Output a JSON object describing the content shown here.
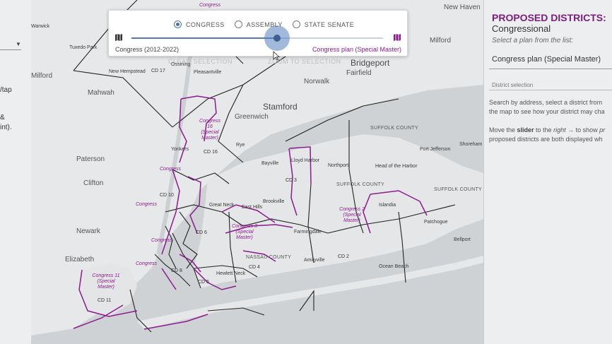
{
  "left_panel": {
    "lines": [
      "/tap",
      "&",
      "int)."
    ]
  },
  "plan_selector": {
    "options": [
      {
        "label": "CONGRESS",
        "checked": true
      },
      {
        "label": "ASSEMBLY",
        "checked": false
      },
      {
        "label": "STATE SENATE",
        "checked": false
      }
    ],
    "slider_value": 0.58,
    "left_caption": "Congress (2012-2022)",
    "right_caption": "Congress plan (Special Master)"
  },
  "map": {
    "ghost_buttons": [
      "CLEAR SELECTION",
      "ZOOM TO SELECTION"
    ],
    "places": [
      "Tuxedo Park",
      "New Hempstead",
      "Ossining",
      "Pleasantville",
      "Milford",
      "Mahwah",
      "Paterson",
      "Clifton",
      "Newark",
      "Elizabeth",
      "Yonkers",
      "Greenwich",
      "Stamford",
      "Rye",
      "Norwalk",
      "Bridgeport",
      "Fairfield",
      "New Haven",
      "Milford",
      "Bayville",
      "Lloyd Harbor",
      "Northport",
      "Head of the Harbor",
      "Port Jefferson",
      "Shoreham",
      "Great Neck",
      "East Hills",
      "Brookville",
      "Farmingdale",
      "Amityville",
      "Hewlett Neck",
      "Islandia",
      "Patchogue",
      "Bellport",
      "Ocean Beach",
      "SUFFOLK COUNTY",
      "SUFFOLK COUNTY",
      "SUFFOLK COUNTY",
      "NASSAU COUNTY",
      "Warwick"
    ],
    "current_districts": [
      "CD 17",
      "CD 16",
      "CD 3",
      "CD 4",
      "CD 2",
      "CD 5",
      "CD 6",
      "CD 8",
      "CD 11",
      "CD 10"
    ],
    "proposed_districts": [
      "Congress 16 (Special Master)",
      "Congress 11 (Special Master)",
      "Congress 3 (Special Master)",
      "Congress 2 (Special Master)",
      "Congress",
      "Congress",
      "Congress",
      "Congress"
    ],
    "top_label": "Congress"
  },
  "info_panel": {
    "heading": "PROPOSED DISTRICTS:",
    "subheading": "Congressional",
    "hint": "Select a plan from the list:",
    "selected_plan": "Congress plan (Special Master)",
    "section_label": "District selection",
    "para1_line1": "Search by address, select a district from",
    "para1_line2": "the map to see how your district may cha",
    "para2_prefix": "Move the ",
    "para2_bold": "slider",
    "para2_mid": " to the ",
    "para2_italic": "right",
    "para2_arrow": " → to show ",
    "para2_tail": "pr",
    "para2_line2": "proposed districts are both displayed wh"
  },
  "colors": {
    "proposed": "#8b1b8e",
    "accent": "#4b6fa6",
    "heading": "#7a1d7c"
  }
}
